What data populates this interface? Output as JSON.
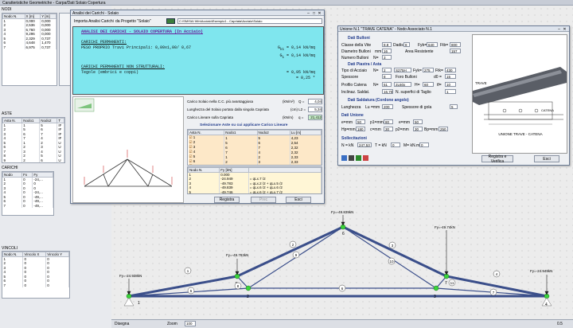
{
  "app": {
    "title": "Caratteristiche Geometriche - Carpa/Dati Solaio Copertura"
  },
  "nodes": {
    "title": "NODI",
    "headers": [
      "Nodo N.",
      "X [m]",
      "Y [m]"
    ],
    "rows": [
      [
        "1",
        "0,000",
        "0,000"
      ],
      [
        "2",
        "2,536",
        "0,000"
      ],
      [
        "3",
        "6,760",
        "0,000"
      ],
      [
        "4",
        "9,296",
        "0,000"
      ],
      [
        "5",
        "2,329",
        "0,737"
      ],
      [
        "6",
        "4,648",
        "1,470"
      ],
      [
        "7",
        "6,975",
        "0,737"
      ]
    ]
  },
  "aste": {
    "title": "ASTE",
    "headers": [
      "Asta N.",
      "Nodo1",
      "Nodo2",
      "T"
    ],
    "rows": [
      [
        "1",
        "1",
        "5",
        "IF"
      ],
      [
        "2",
        "5",
        "6",
        "IF"
      ],
      [
        "3",
        "6",
        "7",
        "IF"
      ],
      [
        "4",
        "7",
        "4",
        "IF"
      ],
      [
        "5",
        "1",
        "2",
        "U"
      ],
      [
        "6",
        "2",
        "3",
        "U"
      ],
      [
        "7",
        "3",
        "4",
        "U"
      ],
      [
        "8",
        "2",
        "5",
        "U"
      ],
      [
        "9",
        "2",
        "6",
        "U"
      ],
      [
        "10",
        "3",
        "6",
        "U"
      ],
      [
        "11",
        "3",
        "7",
        "U"
      ]
    ]
  },
  "carichi": {
    "title": "CARICHI",
    "headers": [
      "Nodo",
      "Fx",
      "Fy"
    ],
    "rows": [
      [
        "1",
        "0",
        "-24,..."
      ],
      [
        "2",
        "0",
        "0"
      ],
      [
        "3",
        "0",
        "0"
      ],
      [
        "4",
        "0",
        "-24,..."
      ],
      [
        "5",
        "0",
        "-49,..."
      ],
      [
        "6",
        "0",
        "-49,..."
      ],
      [
        "7",
        "0",
        "-49,..."
      ]
    ]
  },
  "vincoli": {
    "title": "VINCOLI",
    "headers": [
      "Nodo N.",
      "Vincolo X",
      "Vincolo Y"
    ],
    "rows": [
      [
        "1",
        "0",
        "0"
      ],
      [
        "2",
        "0",
        "0"
      ],
      [
        "3",
        "0",
        "0"
      ],
      [
        "4",
        "0",
        "0"
      ],
      [
        "5",
        "0",
        "0"
      ],
      [
        "6",
        "0",
        "0"
      ],
      [
        "7",
        "0",
        "0"
      ]
    ]
  },
  "carichi_win": {
    "title": "Analisi dei Carichi - Solaio",
    "import_label": "Importa Analisi Carichi",
    "project_label": "da Progetto \"Solaio\"",
    "path": "C:\\SM\\SAI Win\\Acciaio\\Esempio1 - Capriata\\Acciaio\\Solaio",
    "report": {
      "heading": "ANALISI DEI CARICHI - SOLAIO COPERTURA (In Acciaio)",
      "perm": "CARICHI PERMANENTI:",
      "perm_line": "PESO PROPRIO Travi Principali: 0,09x1,00/ 0,67",
      "g1_label": "G",
      "g1_sub": "k1",
      "g1_val": "=     0,14  kN/mq",
      "g1b_label": "G",
      "g1b_sub": "1",
      "g1b_val": "=     0,14  kN/mq",
      "nonstr": "CARICHI PERMANENTI NON STRUTTURALI:",
      "tegole": "Tegole (embrici e coppi)",
      "tegole_val": "=     0,95  kN/mq",
      "g2_val": "=     0,25  *"
    },
    "f1_label": "Carico Solaio nella C.C. più avantaggiosa",
    "f1_unit": "(kN/m²)",
    "f1_sym": "Q =",
    "f1_val": "4,04",
    "f2_label": "Lunghezza del Solaio portato dalla singola Capriata",
    "f2_unit": "(cm) L2 =",
    "f2_val": "5,34",
    "f3_label": "Carico Lineare sulla Capriata",
    "f3_unit": "(kN/m)",
    "f3_sym": "q =",
    "f3_val": "21,412",
    "aste_title": "Selezionare Aste su cui applicare Carico Lineare",
    "aste_headers": [
      "Asta N.",
      "Nodo1",
      "Nodo2",
      "Lu [m]"
    ],
    "aste_rows": [
      [
        "1",
        "1",
        "5",
        "4,23"
      ],
      [
        "2",
        "5",
        "6",
        "2,54"
      ],
      [
        "3",
        "6",
        "7",
        "2,32"
      ],
      [
        "4",
        "7",
        "4",
        "2,32"
      ],
      [
        "5",
        "1",
        "2",
        "2,33"
      ],
      [
        "6",
        "2",
        "3",
        "2,33"
      ],
      [
        "7",
        "3",
        "4",
        "2,33"
      ]
    ],
    "nodi_headers": [
      "Nodo N.",
      "Fy [kN]"
    ],
    "nodi_rows": [
      [
        "1",
        "0.000",
        ""
      ],
      [
        "2",
        "-24.949",
        "= qLx.7 /2"
      ],
      [
        "3",
        "-49.783",
        "= qLx.2 /2 + qLx.5 /2"
      ],
      [
        "4",
        "-49.839",
        "= qLx.6 /2 + qLx.6 /2"
      ],
      [
        "5",
        "-49.746",
        "= qLx.6 /2 + qLx.7 /2"
      ]
    ],
    "btn_registra": "Registra",
    "btn_prev": "Prec",
    "btn_esci": "Esci"
  },
  "unione": {
    "title": "Unione N.1 \"TRAVE CATENA\" - Nodo Associato N.1",
    "s1": "Dati Bulloni",
    "classe_label": "Classe della Vite",
    "classe_val": "8.8",
    "dadiso_label": "Dadiso",
    "dadiso_val": "8",
    "fyb_label": "Fyb=",
    "fyb_val": "640",
    "ftb_label": "Ftb=",
    "ftb_val": "800",
    "diam_label": "Diametro Bulloni",
    "diam_unit": "mm",
    "diam_val": "16",
    "area_label": "Area Resistente",
    "area_val": "157",
    "nb_label": "Numero Bulloni",
    "nb_sym": "N=",
    "nb_val": "3",
    "s2": "Dati Piastra / Asta",
    "tipo_label": "Tipo di Acciaio",
    "tipo_sym": "N=",
    "tipo_val": "2",
    "tipo_name": "S275H",
    "fyk_label": "Fyk=",
    "fyk_val": "275",
    "ftk_label": "Ftk=",
    "ftk_val": "430",
    "spess_label": "Spessore",
    "spess_val": "8",
    "foro_label": "Foro Bulloni",
    "foro_sym": "d0 =",
    "foro_val": "15",
    "profilo_label": "Profilo Catena",
    "profilo_sym": "N=",
    "profilo_val": "51",
    "profilo_name": "2L60x",
    "h_label": "H=",
    "h_val": "60",
    "tf_label": "tf=",
    "tf_val": "10",
    "incl_label": "Inclinaz. Saldat.",
    "incl_val": "16,70",
    "sup_label": "N. superfici di Taglio",
    "sup_val": "1",
    "s3": "Dati Saldatura (Cordone angolo)",
    "lung_label": "Lunghezza",
    "lung_sym": "Lu =mm",
    "lung_val": "200",
    "gola_label": "Spessore di gola",
    "gola_val": "5",
    "s4": "Dati Unione",
    "e1_label": "e=mm",
    "e1_val": "50",
    "e2_label": "p1=mm",
    "e2_val": "80",
    "e3_label": "e=mm",
    "e3_val": "50",
    "hp_label": "Hp=mm",
    "hp_val": "180",
    "c_label": "c=mm",
    "c_val": "30",
    "p2_label": "p2=mm",
    "p2_val": "30",
    "bp_label": "Bp=mm",
    "bp_val": "250",
    "s5": "Sollecitazioni",
    "n_label": "N = kN",
    "n_val": "247,53",
    "t_label": "T = kN",
    "t_val": "0",
    "m_label": "M= kN.m",
    "m_val": "0",
    "img_label": "TRAVE",
    "img_label2": "CATENA",
    "caption": "UNIONE  TRAVE - CATENA",
    "btn_verifica": "Registra e Verifica",
    "btn_esci": "Esci"
  },
  "truss": {
    "loads": [
      "Fy=-24.938kN",
      "Fy=-49.783kN",
      "Fy=-49.839kN",
      "Fy=-49.74kN",
      "Fy=-24.949kN"
    ],
    "node_labels": [
      "1",
      "2",
      "3",
      "4",
      "5",
      "6",
      "7"
    ],
    "member_labels": [
      "1",
      "2",
      "3",
      "4",
      "5",
      "6",
      "7",
      "8",
      "9",
      "10",
      "11"
    ]
  },
  "status": {
    "left": "Disegna",
    "zoom_label": "Zoom",
    "zoom_val": "100",
    "coord": "0.5"
  }
}
